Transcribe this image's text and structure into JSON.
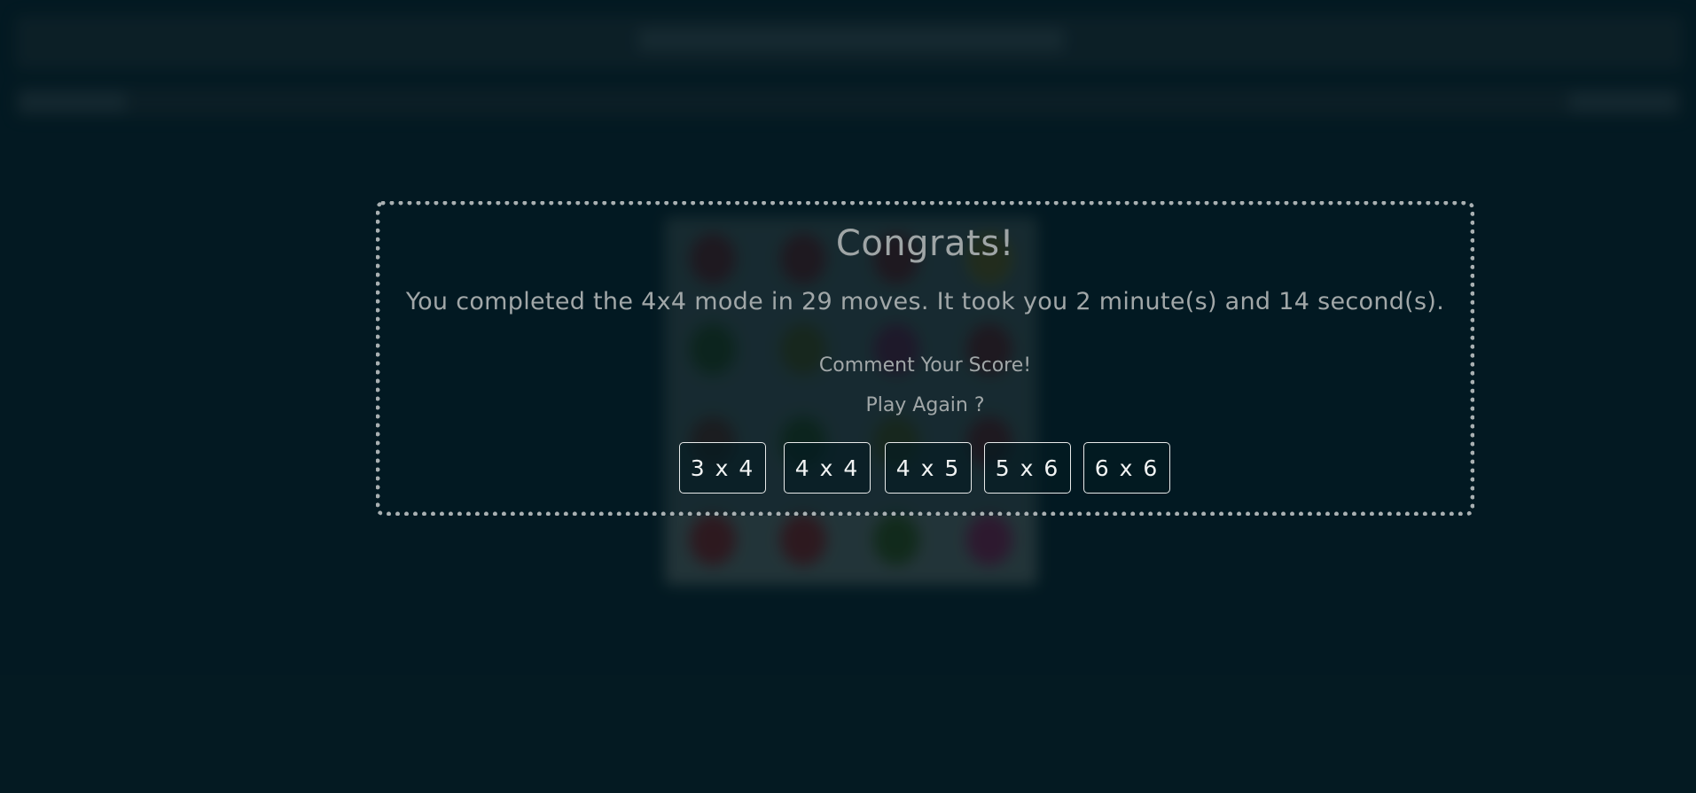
{
  "modal": {
    "title": "Congrats!",
    "message": "You completed the 4x4 mode in 29 moves. It took you 2 minute(s) and 14 second(s).",
    "comment_link": "Comment Your Score!",
    "play_again": "Play Again ?",
    "modes": [
      "3 x 4",
      "4 x 4",
      "4 x 5",
      "5 x 6",
      "6 x 6"
    ]
  },
  "colors": {
    "background": "#041a22",
    "modal_border": "#a9b0b2",
    "text": "#a1a7a8",
    "button_text": "#f2f4f4"
  }
}
